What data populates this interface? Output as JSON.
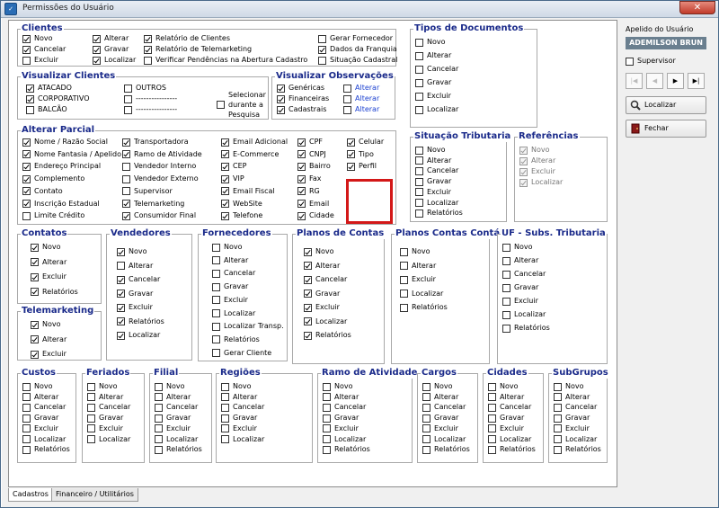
{
  "window": {
    "title": "Permissões do Usuário",
    "close": "✕",
    "icon": "app-icon"
  },
  "clientes": {
    "title": "Clientes",
    "items": [
      {
        "label": "Novo",
        "checked": true
      },
      {
        "label": "Cancelar",
        "checked": true
      },
      {
        "label": "Excluir",
        "checked": false
      },
      {
        "label": "Alterar",
        "checked": true
      },
      {
        "label": "Gravar",
        "checked": true
      },
      {
        "label": "Localizar",
        "checked": true
      },
      {
        "label": "Relatório de Clientes",
        "checked": true
      },
      {
        "label": "Relatório de Telemarketing",
        "checked": true
      },
      {
        "label": "Verificar Pendências na Abertura Cadastro",
        "checked": false
      },
      {
        "label": "Gerar Fornecedor",
        "checked": false
      },
      {
        "label": "Dados da Franquia",
        "checked": true
      },
      {
        "label": "Situação Cadastral",
        "checked": false
      }
    ]
  },
  "visualizar_clientes": {
    "title": "Visualizar Clientes",
    "items": [
      {
        "label": "ATACADO",
        "checked": true
      },
      {
        "label": "CORPORATIVO",
        "checked": true
      },
      {
        "label": "BALCÃO",
        "checked": false
      },
      {
        "label": "OUTROS",
        "checked": false
      },
      {
        "label": "----------------",
        "checked": false
      },
      {
        "label": "----------------",
        "checked": false
      }
    ],
    "selecionar": {
      "label": "Selecionar durante a Pesquisa",
      "checked": false
    }
  },
  "visualizar_observacoes": {
    "title": "Visualizar Observações",
    "items": [
      {
        "label": "Genéricas",
        "checked": true,
        "alterar": "Alterar",
        "alterar_checked": false
      },
      {
        "label": "Financeiras",
        "checked": true,
        "alterar": "Alterar",
        "alterar_checked": false
      },
      {
        "label": "Cadastrais",
        "checked": true,
        "alterar": "Alterar",
        "alterar_checked": false
      }
    ]
  },
  "tipos_documentos": {
    "title": "Tipos de Documentos",
    "items": [
      {
        "label": "Novo",
        "checked": false
      },
      {
        "label": "Alterar",
        "checked": false
      },
      {
        "label": "Cancelar",
        "checked": false
      },
      {
        "label": "Gravar",
        "checked": false
      },
      {
        "label": "Excluir",
        "checked": false
      },
      {
        "label": "Localizar",
        "checked": false
      }
    ]
  },
  "alterar_parcial": {
    "title": "Alterar Parcial",
    "cols": [
      [
        {
          "label": "Nome / Razão Social",
          "checked": true
        },
        {
          "label": "Nome Fantasia / Apelido",
          "checked": true
        },
        {
          "label": "Endereço Principal",
          "checked": true
        },
        {
          "label": "Complemento",
          "checked": true
        },
        {
          "label": "Contato",
          "checked": true
        },
        {
          "label": "Inscrição Estadual",
          "checked": true
        },
        {
          "label": "Limite Crédito",
          "checked": false
        }
      ],
      [
        {
          "label": "Transportadora",
          "checked": true
        },
        {
          "label": "Ramo de Atividade",
          "checked": true
        },
        {
          "label": "Vendedor Interno",
          "checked": false
        },
        {
          "label": "Vendedor Externo",
          "checked": false
        },
        {
          "label": "Supervisor",
          "checked": false
        },
        {
          "label": "Telemarketing",
          "checked": true
        },
        {
          "label": "Consumidor Final",
          "checked": true
        }
      ],
      [
        {
          "label": "Email Adicional",
          "checked": true
        },
        {
          "label": "E-Commerce",
          "checked": true
        },
        {
          "label": "CEP",
          "checked": true
        },
        {
          "label": "VIP",
          "checked": true
        },
        {
          "label": "Email Fiscal",
          "checked": true
        },
        {
          "label": "WebSite",
          "checked": true
        },
        {
          "label": "Telefone",
          "checked": true
        }
      ],
      [
        {
          "label": "CPF",
          "checked": true
        },
        {
          "label": "CNPJ",
          "checked": true
        },
        {
          "label": "Bairro",
          "checked": true
        },
        {
          "label": "Fax",
          "checked": true
        },
        {
          "label": "RG",
          "checked": true
        },
        {
          "label": "Email",
          "checked": true
        },
        {
          "label": "Cidade",
          "checked": true
        }
      ],
      [
        {
          "label": "Celular",
          "checked": true
        },
        {
          "label": "Tipo",
          "checked": true
        },
        {
          "label": "Perfil",
          "checked": true
        }
      ]
    ]
  },
  "situacao_tributaria": {
    "title": "Situação Tributaria",
    "items": [
      {
        "label": "Novo",
        "checked": false
      },
      {
        "label": "Alterar",
        "checked": false
      },
      {
        "label": "Cancelar",
        "checked": false
      },
      {
        "label": "Gravar",
        "checked": false
      },
      {
        "label": "Excluir",
        "checked": false
      },
      {
        "label": "Localizar",
        "checked": false
      },
      {
        "label": "Relatórios",
        "checked": false
      }
    ]
  },
  "referencias": {
    "title": "Referências",
    "items": [
      {
        "label": "Novo",
        "checked": true
      },
      {
        "label": "Alterar",
        "checked": true
      },
      {
        "label": "Excluir",
        "checked": true
      },
      {
        "label": "Localizar",
        "checked": true
      }
    ]
  },
  "contatos": {
    "title": "Contatos",
    "items": [
      {
        "label": "Novo",
        "checked": true
      },
      {
        "label": "Alterar",
        "checked": true
      },
      {
        "label": "Excluir",
        "checked": true
      },
      {
        "label": "Relatórios",
        "checked": true
      }
    ]
  },
  "telemarketing": {
    "title": "Telemarketing",
    "items": [
      {
        "label": "Novo",
        "checked": true
      },
      {
        "label": "Alterar",
        "checked": true
      },
      {
        "label": "Excluir",
        "checked": true
      }
    ]
  },
  "vendedores": {
    "title": "Vendedores",
    "items": [
      {
        "label": "Novo",
        "checked": true
      },
      {
        "label": "Alterar",
        "checked": false
      },
      {
        "label": "Cancelar",
        "checked": true
      },
      {
        "label": "Gravar",
        "checked": true
      },
      {
        "label": "Excluir",
        "checked": true
      },
      {
        "label": "Relatórios",
        "checked": true
      },
      {
        "label": "Localizar",
        "checked": true
      }
    ]
  },
  "fornecedores": {
    "title": "Fornecedores",
    "items": [
      {
        "label": "Novo",
        "checked": false
      },
      {
        "label": "Alterar",
        "checked": false
      },
      {
        "label": "Cancelar",
        "checked": false
      },
      {
        "label": "Gravar",
        "checked": false
      },
      {
        "label": "Excluir",
        "checked": false
      },
      {
        "label": "Localizar",
        "checked": false
      },
      {
        "label": "Localizar Transp.",
        "checked": false
      },
      {
        "label": "Relatórios",
        "checked": false
      },
      {
        "label": "Gerar Cliente",
        "checked": false
      }
    ]
  },
  "planos_contas": {
    "title": "Planos de Contas",
    "items": [
      {
        "label": "Novo",
        "checked": true
      },
      {
        "label": "Alterar",
        "checked": true
      },
      {
        "label": "Cancelar",
        "checked": true
      },
      {
        "label": "Gravar",
        "checked": true
      },
      {
        "label": "Excluir",
        "checked": true
      },
      {
        "label": "Localizar",
        "checked": true
      },
      {
        "label": "Relatórios",
        "checked": true
      }
    ]
  },
  "planos_contas_contabil": {
    "title": "Planos Contas Contábil",
    "items": [
      {
        "label": "Novo",
        "checked": false
      },
      {
        "label": "Alterar",
        "checked": false
      },
      {
        "label": "Excluir",
        "checked": false
      },
      {
        "label": "Localizar",
        "checked": false
      },
      {
        "label": "Relatórios",
        "checked": false
      }
    ]
  },
  "uf_subs": {
    "title": "UF - Subs. Tributaria",
    "items": [
      {
        "label": "Novo",
        "checked": false
      },
      {
        "label": "Alterar",
        "checked": false
      },
      {
        "label": "Cancelar",
        "checked": false
      },
      {
        "label": "Gravar",
        "checked": false
      },
      {
        "label": "Excluir",
        "checked": false
      },
      {
        "label": "Localizar",
        "checked": false
      },
      {
        "label": "Relatórios",
        "checked": false
      }
    ]
  },
  "bottom_groups": [
    {
      "title": "Custos",
      "items": [
        "Novo",
        "Alterar",
        "Cancelar",
        "Gravar",
        "Excluir",
        "Localizar",
        "Relatórios"
      ]
    },
    {
      "title": "Feriados",
      "items": [
        "Novo",
        "Alterar",
        "Cancelar",
        "Gravar",
        "Excluir",
        "Localizar"
      ]
    },
    {
      "title": "Filial",
      "items": [
        "Novo",
        "Alterar",
        "Cancelar",
        "Gravar",
        "Excluir",
        "Localizar",
        "Relatórios"
      ]
    },
    {
      "title": "Regiões",
      "items": [
        "Novo",
        "Alterar",
        "Cancelar",
        "Gravar",
        "Excluir",
        "Localizar"
      ]
    },
    {
      "title": "Ramo de Atividade",
      "items": [
        "Novo",
        "Alterar",
        "Cancelar",
        "Gravar",
        "Excluir",
        "Localizar",
        "Relatórios"
      ]
    },
    {
      "title": "Cargos",
      "items": [
        "Novo",
        "Alterar",
        "Cancelar",
        "Gravar",
        "Excluir",
        "Localizar",
        "Relatórios"
      ]
    },
    {
      "title": "Cidades",
      "items": [
        "Novo",
        "Alterar",
        "Cancelar",
        "Gravar",
        "Excluir",
        "Localizar",
        "Relatórios"
      ]
    },
    {
      "title": "SubGrupos",
      "items": [
        "Novo",
        "Alterar",
        "Cancelar",
        "Gravar",
        "Excluir",
        "Localizar",
        "Relatórios"
      ]
    }
  ],
  "tabs": [
    {
      "label": "Cadastros",
      "active": true
    },
    {
      "label": "Financeiro / Utilitários",
      "active": false
    }
  ],
  "sidebar": {
    "apelido_label": "Apelido do Usuário",
    "apelido_value": "ADEMILSON BRUN",
    "supervisor": {
      "label": "Supervisor",
      "checked": false
    },
    "nav": [
      "|◀",
      "◀",
      "▶",
      "▶|"
    ],
    "localizar": "Localizar",
    "fechar": "Fechar"
  },
  "colors": {
    "title_text": "#1a2a8a",
    "link_blue": "#1a3fd0",
    "highlight_red": "#d31818",
    "apelido_bg": "#6a7f8f"
  }
}
